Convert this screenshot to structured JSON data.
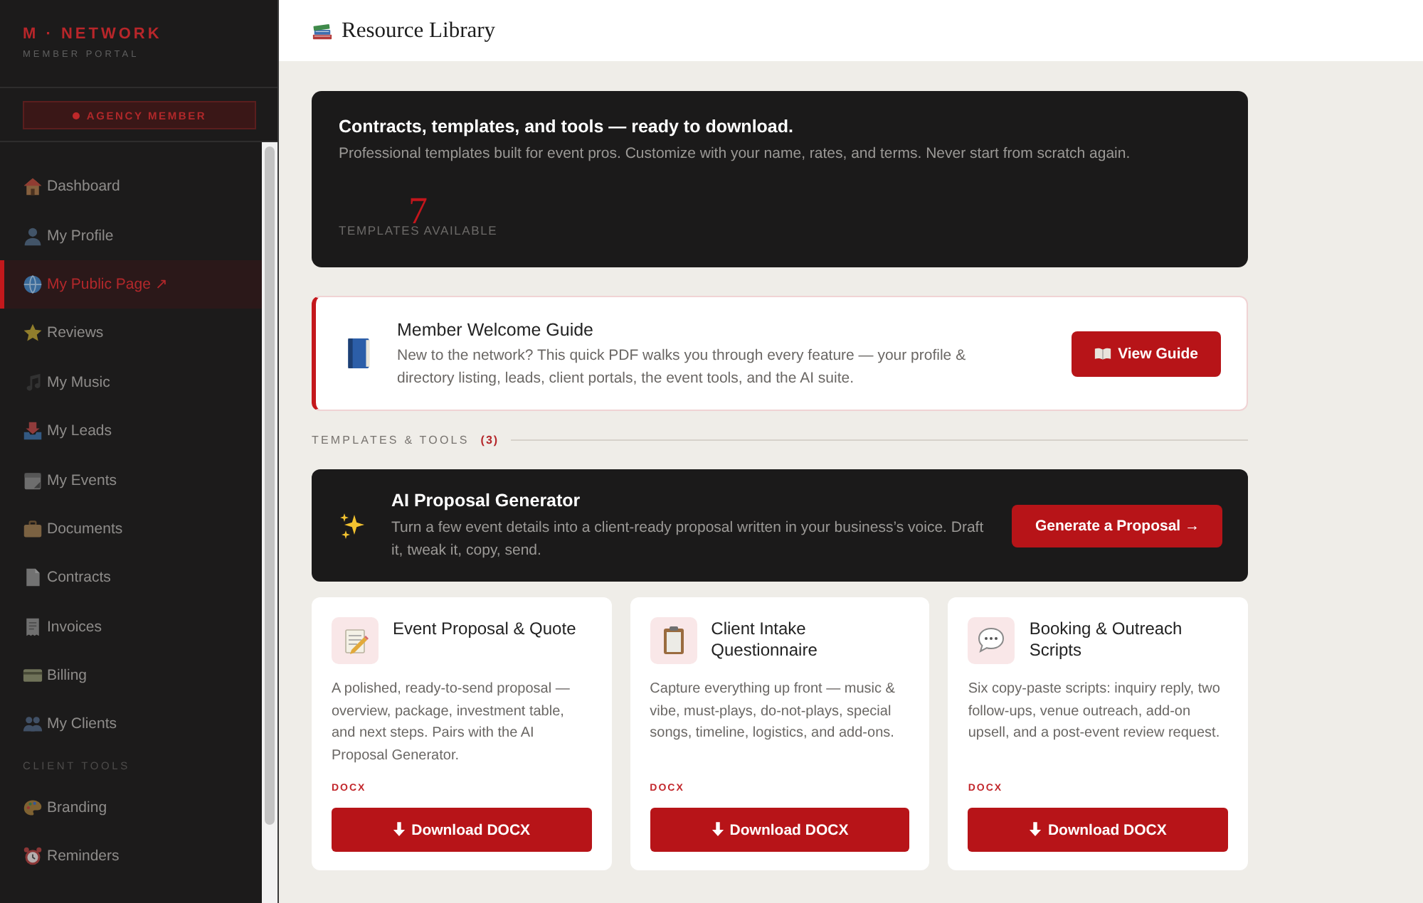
{
  "sidebar": {
    "brand": {
      "title": "M · NETWORK",
      "subtitle": "MEMBER PORTAL"
    },
    "badge": "AGENCY MEMBER",
    "sections": [
      {
        "items": [
          {
            "label": "Dashboard",
            "selected": false
          },
          {
            "label": "My Profile",
            "selected": false
          },
          {
            "label": "My Public Page ↗",
            "selected": true
          },
          {
            "label": "Reviews",
            "selected": false
          },
          {
            "label": "My Music",
            "selected": false
          },
          {
            "label": "My Leads",
            "selected": false
          },
          {
            "label": "My Events",
            "selected": false
          },
          {
            "label": "Documents",
            "selected": false
          },
          {
            "label": "Contracts",
            "selected": false
          },
          {
            "label": "Invoices",
            "selected": false
          },
          {
            "label": "Billing",
            "selected": false
          },
          {
            "label": "My Clients",
            "selected": false
          }
        ]
      },
      {
        "heading": "CLIENT TOOLS",
        "items": [
          {
            "label": "Branding",
            "selected": false
          },
          {
            "label": "Reminders",
            "selected": false
          }
        ]
      }
    ]
  },
  "header": {
    "title": "Resource Library"
  },
  "hero": {
    "title": "Contracts, templates, and tools — ready to download.",
    "subtitle": "Professional templates built for event pros. Customize with your name, rates, and terms. Never start from scratch again.",
    "stat": {
      "value": "7",
      "label": "TEMPLATES AVAILABLE"
    }
  },
  "guide": {
    "title": "Member Welcome Guide",
    "description": "New to the network? This quick PDF walks you through every feature — your profile & directory listing, leads, client portals, the event tools, and the AI suite.",
    "button": "View Guide"
  },
  "section": {
    "label": "TEMPLATES & TOOLS",
    "count": "(3)"
  },
  "ai_tool": {
    "title": "AI Proposal Generator",
    "description": "Turn a few event details into a client-ready proposal written in your business’s voice. Draft it, tweak it, copy, send.",
    "button": "Generate a Proposal →"
  },
  "templates": [
    {
      "title": "Event Proposal & Quote",
      "description": "A polished, ready-to-send proposal — overview, package, investment table, and next steps. Pairs with the AI Proposal Generator.",
      "format": "DOCX",
      "button": "Download DOCX"
    },
    {
      "title": "Client Intake Questionnaire",
      "description": "Capture everything up front — music & vibe, must-plays, do-not-plays, special songs, timeline, logistics, and add-ons.",
      "format": "DOCX",
      "button": "Download DOCX"
    },
    {
      "title": "Booking & Outreach Scripts",
      "description": "Six copy-paste scripts: inquiry reply, two follow-ups, venue outreach, add-on upsell, and a post-event review request.",
      "format": "DOCX",
      "button": "Download DOCX"
    }
  ]
}
